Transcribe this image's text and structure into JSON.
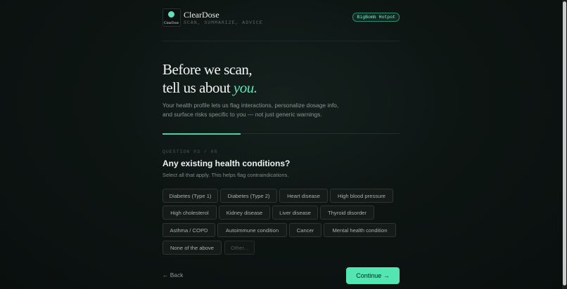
{
  "brand": {
    "logo_text": "ClearDose",
    "name": "ClearDose",
    "tagline": "SCAN, SUMMARIZE, ADVICE",
    "badge": "BigBomb Hotpot"
  },
  "hero": {
    "title_line1": "Before we scan,",
    "title_line2_prefix": "tell us about ",
    "title_line2_accent": "you.",
    "subtitle": "Your health profile lets us flag interactions, personalize dosage info, and surface risks specific to you — not just generic warnings."
  },
  "progress": {
    "current": 3,
    "total": 8,
    "fraction": 0.33
  },
  "question": {
    "number_label": "QUESTION 03 / 08",
    "title": "Any existing health conditions?",
    "help": "Select all that apply. This helps flag contraindications."
  },
  "options": [
    "Diabetes (Type 1)",
    "Diabetes (Type 2)",
    "Heart disease",
    "High blood pressure",
    "High cholesterol",
    "Kidney disease",
    "Liver disease",
    "Thyroid disorder",
    "Asthma / COPD",
    "Autoimmune condition",
    "Cancer",
    "Mental health condition",
    "None of the above",
    "Other..."
  ],
  "nav": {
    "back_label": "← Back",
    "continue_label": "Continue →"
  },
  "colors": {
    "accent": "#54e6b2",
    "background": "#0d1513",
    "chip_border": "#2c3532"
  }
}
